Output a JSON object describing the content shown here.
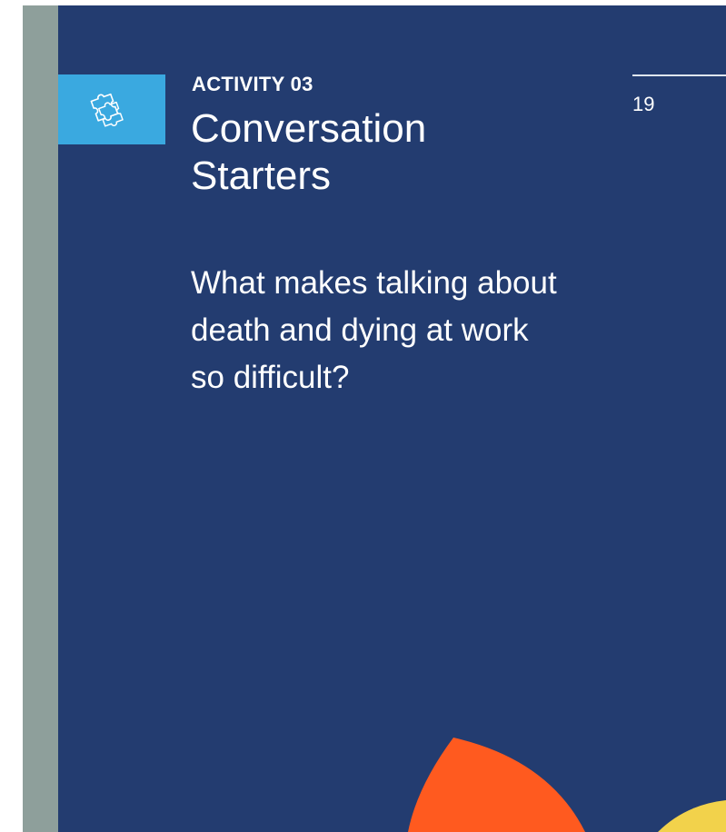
{
  "header": {
    "activity_label": "ACTIVITY 03",
    "title_lines": [
      "Conversation",
      "Starters"
    ],
    "page_number": "19"
  },
  "content": {
    "question_lines": [
      "What makes talking about",
      "death and dying at work",
      "so difficult?"
    ]
  },
  "icons": {
    "activity_icon": "puzzle-pieces-icon"
  },
  "colors": {
    "panel_background": "#233c70",
    "side_strip": "#8e9f9b",
    "icon_box": "#3aa9e0",
    "orange_shape": "#ff5a1f",
    "yellow_shape": "#f2d24b",
    "text": "#ffffff"
  }
}
